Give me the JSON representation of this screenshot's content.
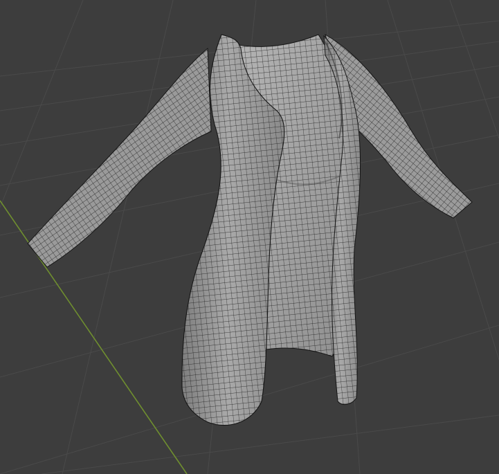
{
  "viewport": {
    "background": "#3d3d3d",
    "grid_color": "#4b4b4b",
    "y_axis_color": "#6f8f2f",
    "object": {
      "name": "cardigan-mesh",
      "shading": "solid-wireframe",
      "base_color": "#9d9d9d",
      "wire_color": "#1a1a1a"
    }
  }
}
